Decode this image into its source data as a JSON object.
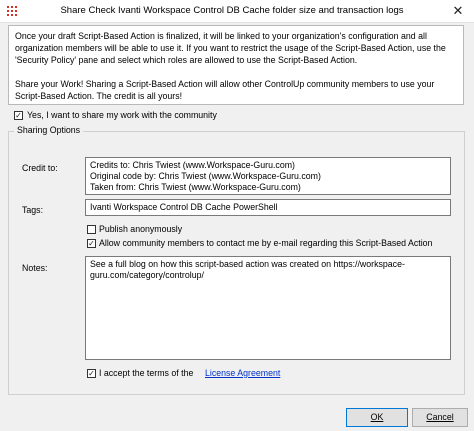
{
  "window": {
    "title": "Share Check Ivanti Workspace Control DB Cache folder size and transaction logs",
    "close_glyph": "✕"
  },
  "info": {
    "paragraph1": "Once your draft Script-Based Action is finalized, it will be linked to your organization's configuration and all organization members will be able to use it. If you want to restrict the usage of the Script-Based Action, use the 'Security Policy' pane and select which roles are allowed to use the Script-Based Action.",
    "paragraph2": "Share your Work! Sharing a Script-Based Action will allow other ControlUp community members to use your Script-Based Action. The credit is all yours!"
  },
  "share_checkbox": {
    "checked": true,
    "label": "Yes, I want to share my work with the community"
  },
  "sharing_options": {
    "legend": "Sharing Options",
    "credit": {
      "label": "Credit to:",
      "line1": "Credits to: Chris Twiest (www.Workspace-Guru.com)",
      "line2": "Original code by: Chris Twiest (www.Workspace-Guru.com)",
      "line3": "Taken from: Chris Twiest (www.Workspace-Guru.com)"
    },
    "tags": {
      "label": "Tags:",
      "value": "Ivanti Workspace Control DB Cache PowerShell"
    },
    "publish_anonymously": {
      "checked": false,
      "label": "Publish anonymously"
    },
    "allow_contact": {
      "checked": true,
      "label": "Allow community members to contact me by e-mail regarding this Script-Based Action"
    },
    "notes": {
      "label": "Notes:",
      "value": "See a full blog on how this script-based action was created on https://workspace-guru.com/category/controlup/"
    },
    "accept_terms": {
      "checked": true,
      "label": "I accept the terms of the",
      "link": "License Agreement"
    }
  },
  "buttons": {
    "ok": "OK",
    "cancel": "Cancel"
  },
  "icons": {
    "app": "controlup-grid-icon",
    "close": "close-icon",
    "check": "checkmark-icon"
  },
  "colors": {
    "link": "#0033cc",
    "default_button_border": "#0078d7"
  }
}
